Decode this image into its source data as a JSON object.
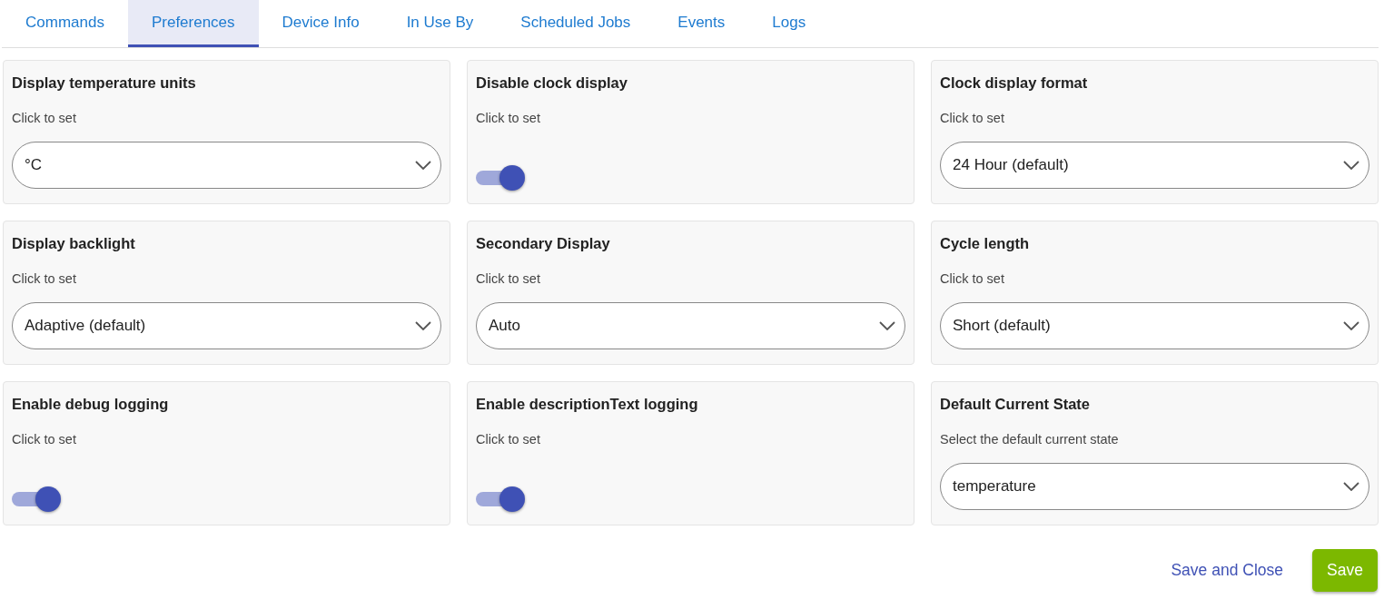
{
  "tabs": [
    {
      "label": "Commands",
      "selected": false
    },
    {
      "label": "Preferences",
      "selected": true
    },
    {
      "label": "Device Info",
      "selected": false
    },
    {
      "label": "In Use By",
      "selected": false
    },
    {
      "label": "Scheduled Jobs",
      "selected": false
    },
    {
      "label": "Events",
      "selected": false
    },
    {
      "label": "Logs",
      "selected": false
    }
  ],
  "preferences": [
    {
      "kind": "select",
      "title": "Display temperature units",
      "hint": "Click to set",
      "value": "°C"
    },
    {
      "kind": "toggle",
      "title": "Disable clock display",
      "hint": "Click to set",
      "on": true
    },
    {
      "kind": "select",
      "title": "Clock display format",
      "hint": "Click to set",
      "value": "24 Hour (default)"
    },
    {
      "kind": "select",
      "title": "Display backlight",
      "hint": "Click to set",
      "value": "Adaptive (default)"
    },
    {
      "kind": "select",
      "title": "Secondary Display",
      "hint": "Click to set",
      "value": "Auto"
    },
    {
      "kind": "select",
      "title": "Cycle length",
      "hint": "Click to set",
      "value": "Short (default)"
    },
    {
      "kind": "toggle",
      "title": "Enable debug logging",
      "hint": "Click to set",
      "on": true
    },
    {
      "kind": "toggle",
      "title": "Enable descriptionText logging",
      "hint": "Click to set",
      "on": true
    },
    {
      "kind": "select",
      "title": "Default Current State",
      "hint": "Select the default current state",
      "value": "temperature"
    }
  ],
  "actions": {
    "save_and_close": "Save and Close",
    "save": "Save"
  }
}
